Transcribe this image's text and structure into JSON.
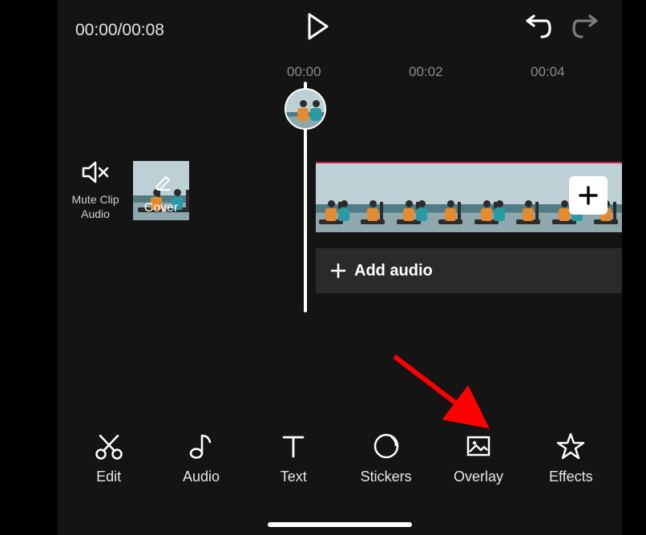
{
  "topbar": {
    "time_display": "00:00/00:08"
  },
  "ruler": {
    "ticks": [
      "00:00",
      "00:02",
      "00:04"
    ]
  },
  "timeline": {
    "mute_label": "Mute Clip Audio",
    "cover_label": "Cover",
    "add_audio_label": "Add audio"
  },
  "toolbar": {
    "items": [
      {
        "label": "Edit"
      },
      {
        "label": "Audio"
      },
      {
        "label": "Text"
      },
      {
        "label": "Stickers"
      },
      {
        "label": "Overlay"
      },
      {
        "label": "Effects"
      }
    ]
  }
}
